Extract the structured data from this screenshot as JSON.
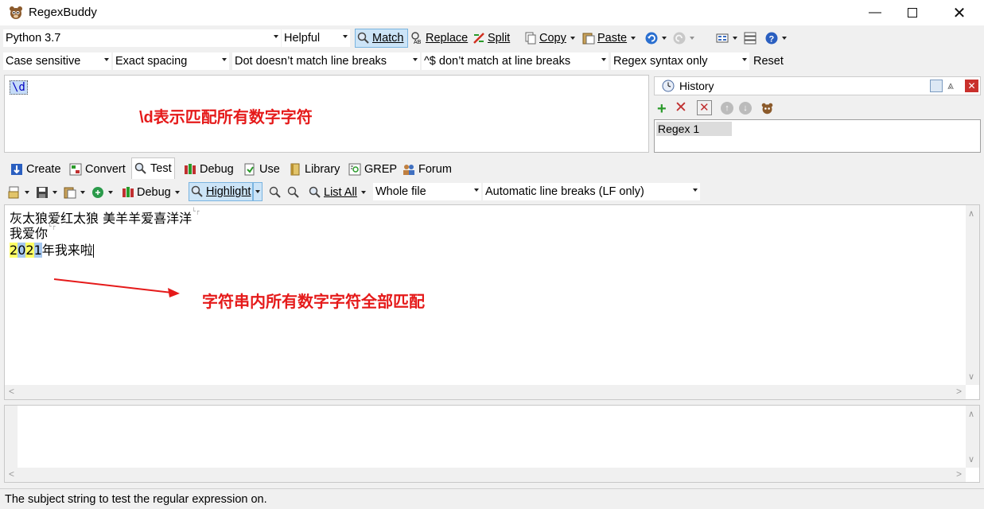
{
  "window": {
    "title": "RegexBuddy"
  },
  "toolbar1": {
    "flavor": "Python 3.7",
    "mode": "Helpful",
    "match_label": "Match",
    "replace_label": "Replace",
    "split_label": "Split",
    "copy_label": "Copy",
    "paste_label": "Paste"
  },
  "toolbar2": {
    "case": "Case sensitive",
    "spacing": "Exact spacing",
    "dot": "Dot doesn’t match line breaks",
    "anchors": "^$ don’t match at line breaks",
    "syntax": "Regex syntax only",
    "reset": "Reset"
  },
  "regex": {
    "value": "\\d",
    "annotation": "\\d表示匹配所有数字字符"
  },
  "history": {
    "title": "History",
    "items": [
      "Regex 1"
    ]
  },
  "tabs": [
    "Create",
    "Convert",
    "Test",
    "Debug",
    "Use",
    "Library",
    "GREP",
    "Forum"
  ],
  "active_tab": "Test",
  "test_toolbar": {
    "debug_label": "Debug",
    "highlight_label": "Highlight",
    "list_all_label": "List All",
    "scope": "Whole file",
    "line_breaks": "Automatic line breaks (LF only)"
  },
  "test_subject": {
    "line1": "灰太狼爱红太狼 美羊羊爱喜洋洋",
    "line2": "我爱你",
    "line3_match_1": "2",
    "line3_match_2": "0",
    "line3_match_3": "2",
    "line3_match_4": "1",
    "line3_rest": "年我来啦",
    "annotation": "字符串内所有数字字符全部匹配"
  },
  "status": {
    "text": "The subject string to test the regular expression on."
  }
}
